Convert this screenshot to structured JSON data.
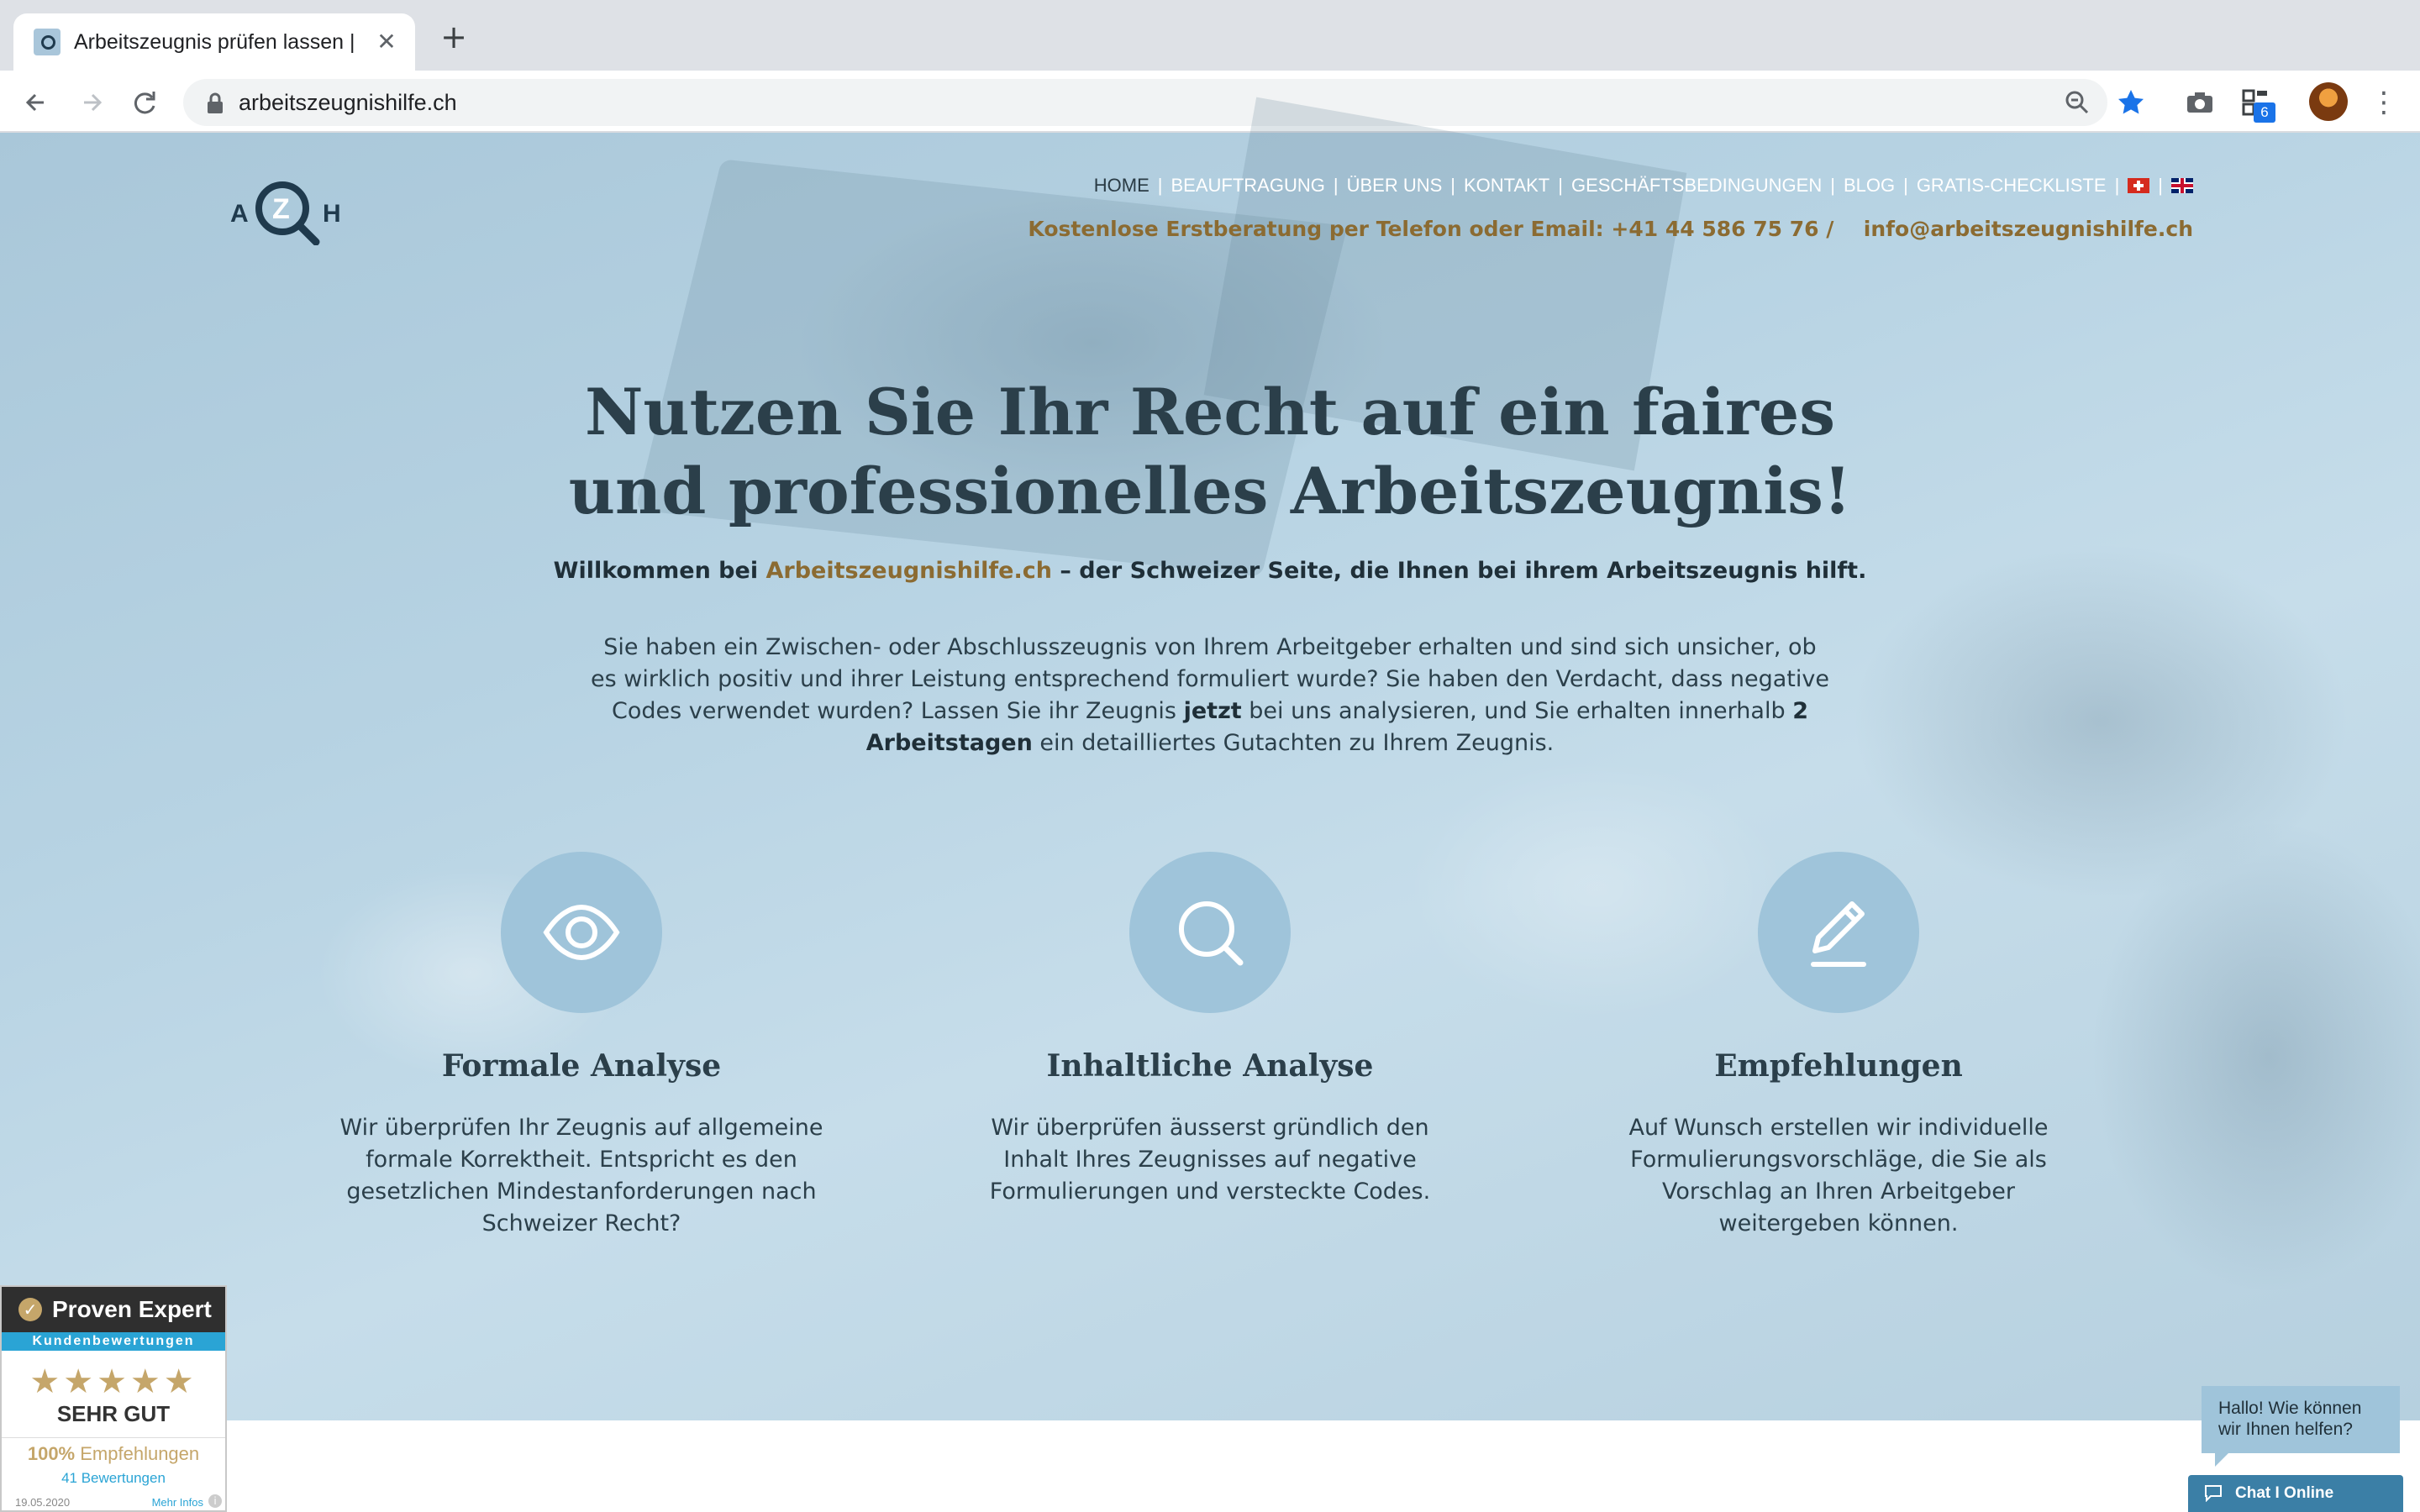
{
  "browser": {
    "tab_title": "Arbeitszeugnis prüfen lassen |",
    "tab_close": "✕",
    "new_tab": "+",
    "url": "arbeitszeugnishilfe.ch",
    "extension_badge": "6",
    "menu": "⋮"
  },
  "site": {
    "logo": "AZH",
    "nav": [
      {
        "label": "HOME",
        "active": true
      },
      {
        "label": "BEAUFTRAGUNG"
      },
      {
        "label": "ÜBER UNS"
      },
      {
        "label": "KONTAKT"
      },
      {
        "label": "GESCHÄFTSBEDINGUNGEN"
      },
      {
        "label": "BLOG"
      },
      {
        "label": "GRATIS-CHECKLISTE"
      }
    ],
    "nav_separator": "|",
    "contact": {
      "label": "Kostenlose Erstberatung per Telefon oder Email:",
      "phone": "+41 44 586 75 76 /",
      "email": "info@arbeitszeugnishilfe.ch"
    }
  },
  "hero": {
    "title": "Nutzen Sie Ihr Recht auf ein faires und professionelles Arbeitszeugnis!",
    "welcome_prefix": "Willkommen bei",
    "welcome_brand": "Arbeitszeugnishilfe.ch",
    "welcome_suffix": "– der Schweizer Seite, die Ihnen bei ihrem Arbeitszeugnis hilft.",
    "intro_1": "Sie haben ein Zwischen- oder Abschlusszeugnis von Ihrem Arbeitgeber erhalten und sind sich unsicher, ob es wirklich positiv und ihrer Leistung entsprechend formuliert wurde? Sie haben den Verdacht, dass negative Codes verwendet wurden? Lassen Sie ihr Zeugnis",
    "intro_bold_1": "jetzt",
    "intro_2": "bei uns analysieren, und Sie erhalten innerhalb",
    "intro_bold_2": "2 Arbeitstagen",
    "intro_3": "ein detailliertes Gutachten zu Ihrem Zeugnis."
  },
  "features": [
    {
      "icon": "eye-icon",
      "title": "Formale Analyse",
      "text": "Wir überprüfen Ihr Zeugnis auf allgemeine formale Korrektheit. Entspricht es den gesetzlichen Mindestanforderungen nach Schweizer Recht?"
    },
    {
      "icon": "search-icon",
      "title": "Inhaltliche Analyse",
      "text": "Wir überprüfen äusserst gründlich den Inhalt Ihres Zeugnisses auf negative Formulierungen und versteckte Codes."
    },
    {
      "icon": "pencil-icon",
      "title": "Empfehlungen",
      "text": "Auf Wunsch erstellen wir individuelle Formulierungsvorschläge, die Sie als Vorschlag an Ihren Arbeitgeber weitergeben können."
    }
  ],
  "proven_expert": {
    "brand": "Proven Expert",
    "subtitle": "Kundenbewertungen",
    "stars": "★★★★★",
    "rating": "SEHR GUT",
    "recommend_pct": "100%",
    "recommend_label": "Empfehlungen",
    "reviews": "41 Bewertungen",
    "date": "19.05.2020",
    "more": "Mehr Infos",
    "info": "i"
  },
  "chat": {
    "bubble": "Hallo! Wie können wir Ihnen helfen?",
    "button": "Chat I Online"
  },
  "colors": {
    "accent_gold": "#8b6b32",
    "heading": "#2b3f4a",
    "feature_circle": "#9fc4da",
    "chat_button": "#3b7fa6"
  }
}
